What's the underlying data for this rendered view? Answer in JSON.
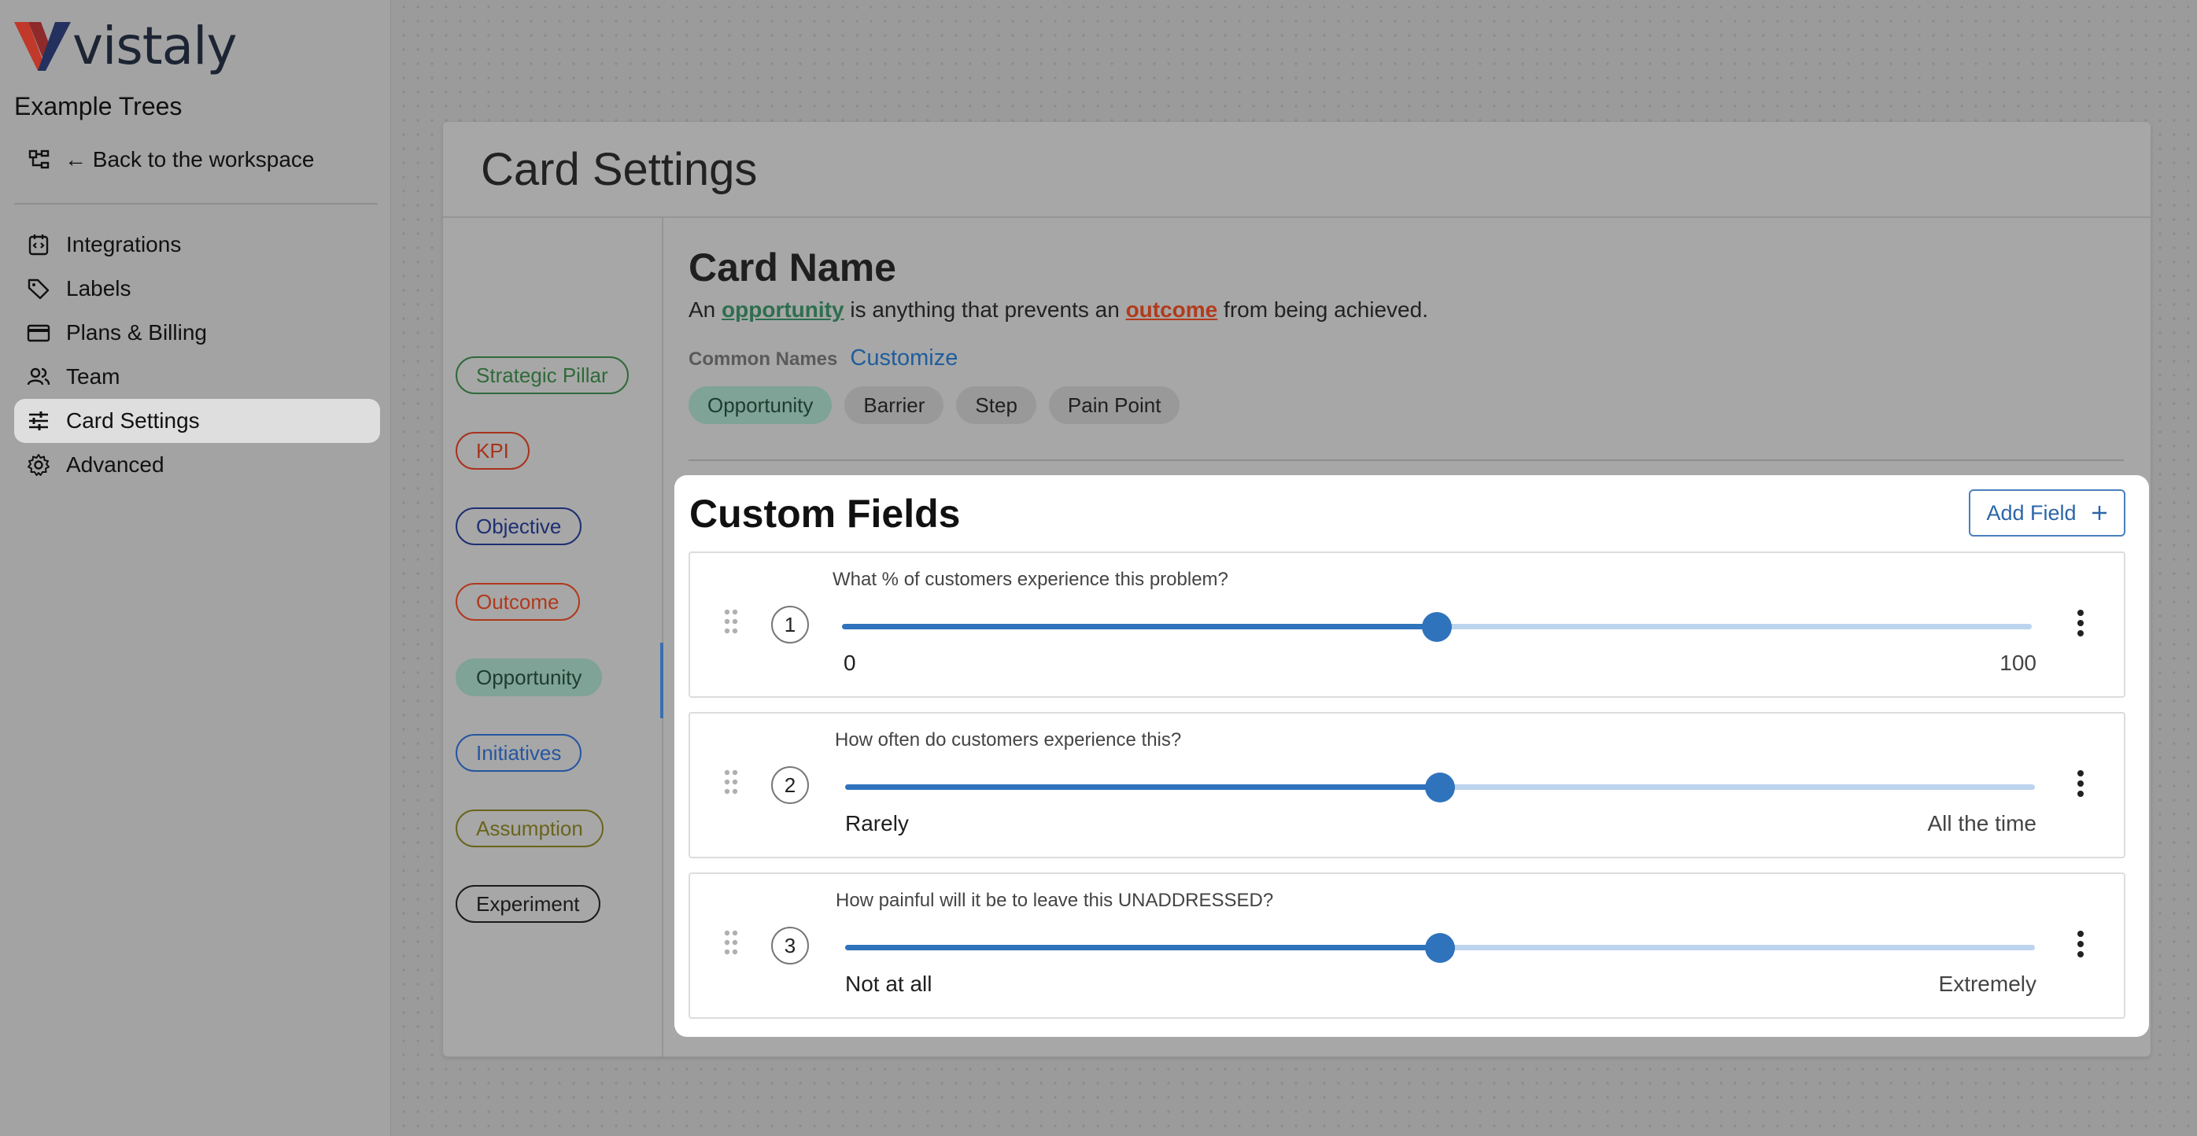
{
  "brand": {
    "name": "vistaly",
    "mark_color_red": "#c0392b",
    "mark_color_navy": "#24315e"
  },
  "workspace": {
    "name": "Example Trees",
    "back_label": "← Back to the workspace"
  },
  "nav": [
    {
      "label": "Integrations",
      "icon": "integrations-icon",
      "active": false
    },
    {
      "label": "Labels",
      "icon": "tag-icon",
      "active": false
    },
    {
      "label": "Plans & Billing",
      "icon": "credit-card-icon",
      "active": false
    },
    {
      "label": "Team",
      "icon": "team-icon",
      "active": false
    },
    {
      "label": "Card Settings",
      "icon": "sliders-icon",
      "active": true
    },
    {
      "label": "Advanced",
      "icon": "gear-icon",
      "active": false
    }
  ],
  "page": {
    "title": "Card Settings"
  },
  "card_types": [
    {
      "label": "Strategic Pillar",
      "color": "#2f6a3a"
    },
    {
      "label": "KPI",
      "color": "#a8321d"
    },
    {
      "label": "Objective",
      "color": "#1e2f72"
    },
    {
      "label": "Outcome",
      "color": "#b0391d"
    },
    {
      "label": "Opportunity",
      "color": "#2e6e4f",
      "selected": true
    },
    {
      "label": "Initiatives",
      "color": "#2556a0"
    },
    {
      "label": "Assumption",
      "color": "#6a641c"
    },
    {
      "label": "Experiment",
      "color": "#1b1b1b"
    }
  ],
  "card": {
    "heading": "Card Name",
    "desc_prefix": "An",
    "desc_opportunity": "opportunity",
    "desc_middle": "is anything that prevents an",
    "desc_outcome": "outcome",
    "desc_suffix": "from being achieved.",
    "common_names_label": "Common Names",
    "customize_label": "Customize",
    "names": [
      {
        "label": "Opportunity",
        "selected": true
      },
      {
        "label": "Barrier"
      },
      {
        "label": "Step"
      },
      {
        "label": "Pain Point"
      }
    ]
  },
  "custom_fields": {
    "title": "Custom Fields",
    "add_label": "Add Field",
    "fields": [
      {
        "number": "1",
        "question": "What % of customers experience this problem?",
        "min_label": "0",
        "max_label": "100",
        "value": 0.5
      },
      {
        "number": "2",
        "question": "How often do customers experience this?",
        "min_label": "Rarely",
        "max_label": "All the time",
        "value": 0.5
      },
      {
        "number": "3",
        "question": "How painful will it be to leave this UNADDRESSED?",
        "min_label": "Not at all",
        "max_label": "Extremely",
        "value": 0.5
      }
    ]
  }
}
